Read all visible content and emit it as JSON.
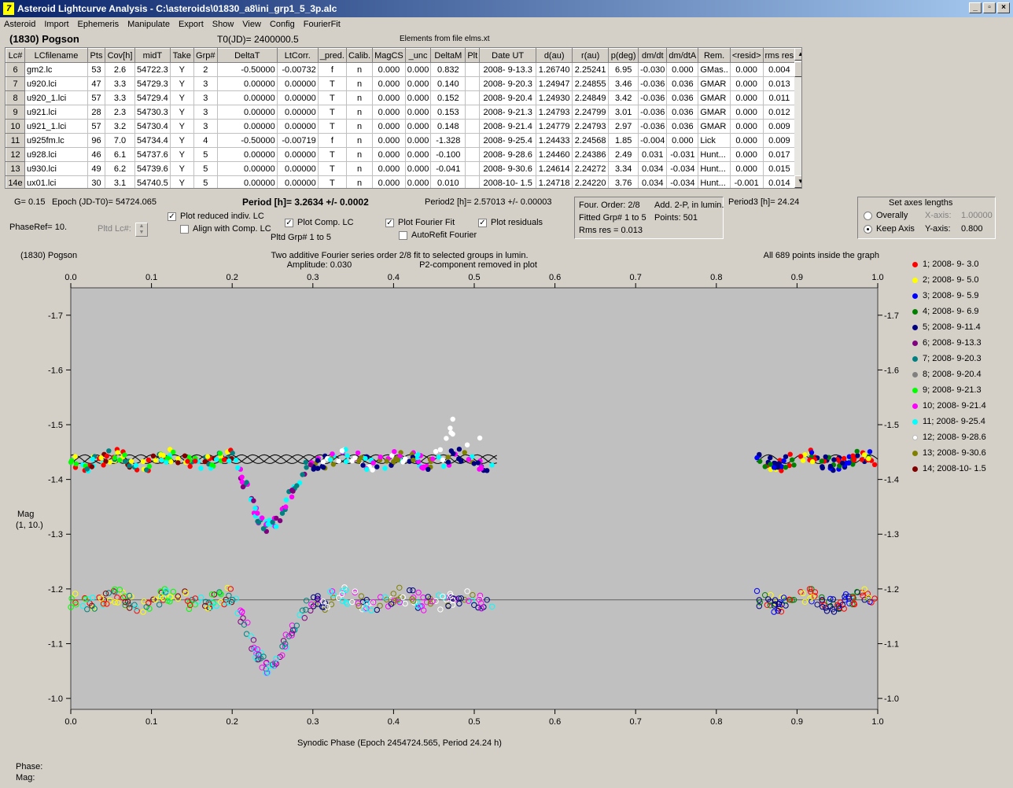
{
  "window": {
    "title": "Asteroid Lightcurve Analysis - C:\\asteroids\\01830_a8\\ini_grp1_5_3p.alc",
    "app_icon": "7",
    "btn_min": "_",
    "btn_max": "▫",
    "btn_close": "×"
  },
  "menu": [
    "Asteroid",
    "Import",
    "Ephemeris",
    "Manipulate",
    "Export",
    "Show",
    "View",
    "Config",
    "FourierFit"
  ],
  "header": {
    "object": "(1830) Pogson",
    "t0": "T0(JD)= 2400000.5",
    "elements": "Elements from file elms.xt"
  },
  "table": {
    "columns": [
      "Lc#",
      "LCfilename",
      "Pts",
      "Cov[h]",
      "midT",
      "Take",
      "Grp#",
      "DeltaT",
      "LtCorr.",
      "_pred.",
      "Calib.",
      "MagCS",
      "_unc",
      "DeltaM",
      "Plt",
      "Date UT",
      "d(au)",
      "r(au)",
      "p(deg)",
      "dm/dt",
      "dm/dtA",
      "Rem.",
      "<resid>",
      "rms res"
    ],
    "rows": [
      [
        "6",
        "gm2.lc",
        "53",
        "2.6",
        "54722.3",
        "Y",
        "2",
        "-0.50000",
        "-0.00732",
        "f",
        "n",
        "0.000",
        "0.000",
        "0.832",
        "",
        "2008- 9-13.3",
        "1.26740",
        "2.25241",
        "6.95",
        "-0.030",
        "0.000",
        "GMas..",
        "0.000",
        "0.004"
      ],
      [
        "7",
        "u920.lci",
        "47",
        "3.3",
        "54729.3",
        "Y",
        "3",
        "0.00000",
        "0.00000",
        "T",
        "n",
        "0.000",
        "0.000",
        "0.140",
        "",
        "2008- 9-20.3",
        "1.24947",
        "2.24855",
        "3.46",
        "-0.036",
        "0.036",
        "GMAR",
        "0.000",
        "0.013"
      ],
      [
        "8",
        "u920_1.lci",
        "57",
        "3.3",
        "54729.4",
        "Y",
        "3",
        "0.00000",
        "0.00000",
        "T",
        "n",
        "0.000",
        "0.000",
        "0.152",
        "",
        "2008- 9-20.4",
        "1.24930",
        "2.24849",
        "3.42",
        "-0.036",
        "0.036",
        "GMAR",
        "0.000",
        "0.011"
      ],
      [
        "9",
        "u921.lci",
        "28",
        "2.3",
        "54730.3",
        "Y",
        "3",
        "0.00000",
        "0.00000",
        "T",
        "n",
        "0.000",
        "0.000",
        "0.153",
        "",
        "2008- 9-21.3",
        "1.24793",
        "2.24799",
        "3.01",
        "-0.036",
        "0.036",
        "GMAR",
        "0.000",
        "0.012"
      ],
      [
        "10",
        "u921_1.lci",
        "57",
        "3.2",
        "54730.4",
        "Y",
        "3",
        "0.00000",
        "0.00000",
        "T",
        "n",
        "0.000",
        "0.000",
        "0.148",
        "",
        "2008- 9-21.4",
        "1.24779",
        "2.24793",
        "2.97",
        "-0.036",
        "0.036",
        "GMAR",
        "0.000",
        "0.009"
      ],
      [
        "11",
        "u925fm.lc",
        "96",
        "7.0",
        "54734.4",
        "Y",
        "4",
        "-0.50000",
        "-0.00719",
        "f",
        "n",
        "0.000",
        "0.000",
        "-1.328",
        "",
        "2008- 9-25.4",
        "1.24433",
        "2.24568",
        "1.85",
        "-0.004",
        "0.000",
        "Lick",
        "0.000",
        "0.009"
      ],
      [
        "12",
        "u928.lci",
        "46",
        "6.1",
        "54737.6",
        "Y",
        "5",
        "0.00000",
        "0.00000",
        "T",
        "n",
        "0.000",
        "0.000",
        "-0.100",
        "",
        "2008- 9-28.6",
        "1.24460",
        "2.24386",
        "2.49",
        "0.031",
        "-0.031",
        "Hunt...",
        "0.000",
        "0.017"
      ],
      [
        "13",
        "u930.lci",
        "49",
        "6.2",
        "54739.6",
        "Y",
        "5",
        "0.00000",
        "0.00000",
        "T",
        "n",
        "0.000",
        "0.000",
        "-0.041",
        "",
        "2008- 9-30.6",
        "1.24614",
        "2.24272",
        "3.34",
        "0.034",
        "-0.034",
        "Hunt...",
        "0.000",
        "0.015"
      ],
      [
        "14e",
        "ux01.lci",
        "30",
        "3.1",
        "54740.5",
        "Y",
        "5",
        "0.00000",
        "0.00000",
        "T",
        "n",
        "0.000",
        "0.000",
        "0.010",
        "",
        "2008-10- 1.5",
        "1.24718",
        "2.24220",
        "3.76",
        "0.034",
        "-0.034",
        "Hunt...",
        "-0.001",
        "0.014"
      ]
    ]
  },
  "controls": {
    "g": "G= 0.15",
    "epoch": "Epoch (JD-T0)= 54724.065",
    "period": "Period [h]= 3.2634 +/- 0.0002",
    "period2": "Period2 [h]= 2.57013 +/- 0.00003",
    "period3": "Period3 [h]= 24.24",
    "phaseref": "PhaseRef= 10.",
    "pltd_lc": "Pltd Lc#:",
    "plot_reduced": "Plot reduced indiv. LC",
    "align_comp": "Align with Comp. LC",
    "plot_comp": "Plot Comp. LC",
    "pltd_grp": "Pltd Grp#  1   to   5",
    "plot_fourier": "Plot Fourier Fit",
    "autorefit": "AutoRefit Fourier",
    "plot_resid": "Plot residuals",
    "four_order": "Four. Order:  2/8",
    "add2p": "Add. 2-P, in lumin.",
    "fitted": "Fitted Grp# 1 to 5",
    "points": "Points: 501",
    "rms": "Rms res      = 0.013",
    "axes_title": "Set axes lengths",
    "overally": "Overally",
    "keep_axis": "Keep Axis",
    "xaxis_label": "X-axis:",
    "xaxis_val": "1.00000",
    "yaxis_label": "Y-axis:",
    "yaxis_val": "0.800"
  },
  "chart_data": {
    "type": "scatter",
    "title_left": "(1830) Pogson",
    "title_center": "Two additive Fourier series order 2/8 fit to selected groups in lumin.",
    "title_center2": "Amplitude: 0.030",
    "title_center3": "P2-component removed in plot",
    "title_right": "All 689 points inside the graph",
    "xlabel": "Synodic Phase (Epoch 2454724.565, Period 24.24 h)",
    "ylabel": "Mag",
    "ylabel2": "(1, 10.)",
    "xlim": [
      0.0,
      1.0
    ],
    "ylim": [
      -1.75,
      -0.98
    ],
    "x_ticks": [
      "0.0",
      "0.1",
      "0.2",
      "0.3",
      "0.4",
      "0.5",
      "0.6",
      "0.7",
      "0.8",
      "0.9",
      "1.0"
    ],
    "y_ticks": [
      "-1.7",
      "-1.6",
      "-1.5",
      "-1.4",
      "-1.3",
      "-1.2",
      "-1.1",
      "-1.0"
    ],
    "series": [
      {
        "name": "1; 2008- 9- 3.0",
        "color": "#ff0000"
      },
      {
        "name": "2; 2008- 9- 5.0",
        "color": "#ffff00"
      },
      {
        "name": "3; 2008- 9- 5.9",
        "color": "#0000ff"
      },
      {
        "name": "4; 2008- 9- 6.9",
        "color": "#008000"
      },
      {
        "name": "5; 2008- 9-11.4",
        "color": "#000080"
      },
      {
        "name": "6; 2008- 9-13.3",
        "color": "#800080"
      },
      {
        "name": "7; 2008- 9-20.3",
        "color": "#008080"
      },
      {
        "name": "8; 2008- 9-20.4",
        "color": "#808080"
      },
      {
        "name": "9; 2008- 9-21.3",
        "color": "#00ff00"
      },
      {
        "name": "10; 2008- 9-21.4",
        "color": "#ff00ff"
      },
      {
        "name": "11; 2008- 9-25.4",
        "color": "#00ffff"
      },
      {
        "name": "12; 2008- 9-28.6",
        "color": "#ffffff"
      },
      {
        "name": "13; 2008- 9-30.6",
        "color": "#808000"
      },
      {
        "name": "14; 2008-10- 1.5",
        "color": "#800000"
      }
    ]
  },
  "status": {
    "phase": "Phase:",
    "mag": "Mag:"
  }
}
